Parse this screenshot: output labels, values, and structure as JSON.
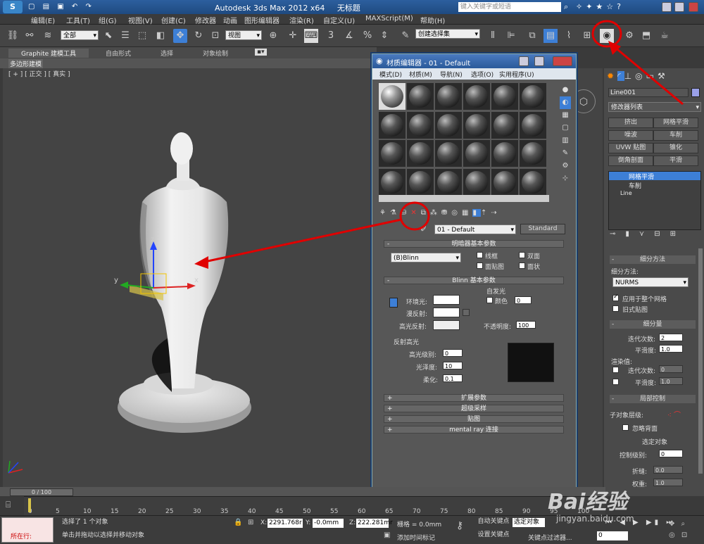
{
  "app": {
    "title": "Autodesk 3ds Max  2012 x64",
    "file_name": "无标题",
    "search_placeholder": "键入关键字或短语"
  },
  "menu": [
    "编辑(E)",
    "工具(T)",
    "组(G)",
    "视图(V)",
    "创建(C)",
    "修改器",
    "动画",
    "图形编辑器",
    "渲染(R)",
    "自定义(U)",
    "MAXScript(M)",
    "帮助(H)"
  ],
  "toolbar": {
    "selection_filter": "全部",
    "reference_coord": "视图",
    "named_selection": "创建选择集"
  },
  "ribbon": {
    "tabs": [
      "Graphite 建模工具",
      "自由形式",
      "选择",
      "对象绘制"
    ],
    "sub": "多边形建模"
  },
  "viewport": {
    "label": "[ + ] [ 正交 ] [ 真实 ]",
    "axis_x": "x",
    "axis_y": "y",
    "axis_z": "z"
  },
  "material_editor": {
    "title": "材质编辑器 - 01 - Default",
    "menu": [
      "模式(D)",
      "材质(M)",
      "导航(N)",
      "选项(O)",
      "实用程序(U)"
    ],
    "material_name": "01 - Default",
    "material_type": "Standard",
    "shader_rollout": "明暗器基本参数",
    "shader_type": "(B)Blinn",
    "shader_opts": [
      "线框",
      "双面",
      "面贴图",
      "面状"
    ],
    "blinn_rollout": "Blinn 基本参数",
    "self_illum": "自发光",
    "color_label": "颜色",
    "color_value": "0",
    "ambient": "环境光:",
    "diffuse": "漫反射:",
    "specular": "高光反射:",
    "opacity_label": "不透明度:",
    "opacity_value": "100",
    "spec_group": "反射高光",
    "spec_level_label": "高光级别:",
    "spec_level": "0",
    "gloss_label": "光泽度:",
    "gloss": "10",
    "soften_label": "柔化:",
    "soften": "0.1",
    "rollouts": [
      "扩展参数",
      "超级采样",
      "贴图",
      "mental ray 连接"
    ]
  },
  "command_panel": {
    "object_name": "Line001",
    "modifier_list": "修改器列表",
    "buttons": [
      "挤出",
      "网格平滑",
      "噪波",
      "车削",
      "UVW 贴图",
      "锥化",
      "倒角剖面",
      "平滑"
    ],
    "stack": [
      "网格平滑",
      "车削",
      "Line"
    ],
    "subdiv_method_hdr": "细分方法",
    "subdiv_method_label": "细分方法:",
    "subdiv_method": "NURMS",
    "apply_whole": "应用于整个网格",
    "old_mapping": "旧式贴图",
    "subdiv_amount_hdr": "细分量",
    "iterations_label": "迭代次数:",
    "iterations": "2",
    "smoothness_label": "平滑度:",
    "smoothness": "1.0",
    "render_values": "渲染值:",
    "r_iterations": "0",
    "r_smoothness": "1.0",
    "local_ctrl_hdr": "局部控制",
    "subobj_level": "子对象层级:",
    "ignore_back": "忽略背面",
    "sel_obj": "选定对象",
    "ctrl_level_label": "控制级别:",
    "ctrl_level": "0",
    "crease_label": "折缝:",
    "crease": "0.0",
    "weight_label": "权重:",
    "weight": "1.0"
  },
  "timeline": {
    "slider": "0 / 100",
    "ticks": [
      "0",
      "5",
      "10",
      "15",
      "20",
      "25",
      "30",
      "35",
      "40",
      "45",
      "50",
      "55",
      "60",
      "65",
      "70",
      "75",
      "80",
      "85",
      "90",
      "95",
      "100"
    ]
  },
  "status": {
    "current": "所在行:",
    "message1": "选择了 1 个对象",
    "message2": "单击并拖动以选择并移动对象",
    "x_label": "X:",
    "x": "2291.768r",
    "y_label": "Y:",
    "y": "-0.0mm",
    "z_label": "Z:",
    "z": "222.281mr",
    "grid": "栅格 = 0.0mm",
    "add_time_tag": "添加时间标记",
    "auto_key": "自动关键点",
    "set_key": "设置关键点",
    "selected": "选定对象",
    "key_filter": "关键点过滤器...",
    "frame": "0"
  },
  "watermark": {
    "brand": "Bai经验",
    "url": "jingyan.baidu.com"
  },
  "colors": {
    "annotation": "#e00000",
    "titlebar": "#2c5f9e",
    "highlight": "#3d7fd6"
  }
}
